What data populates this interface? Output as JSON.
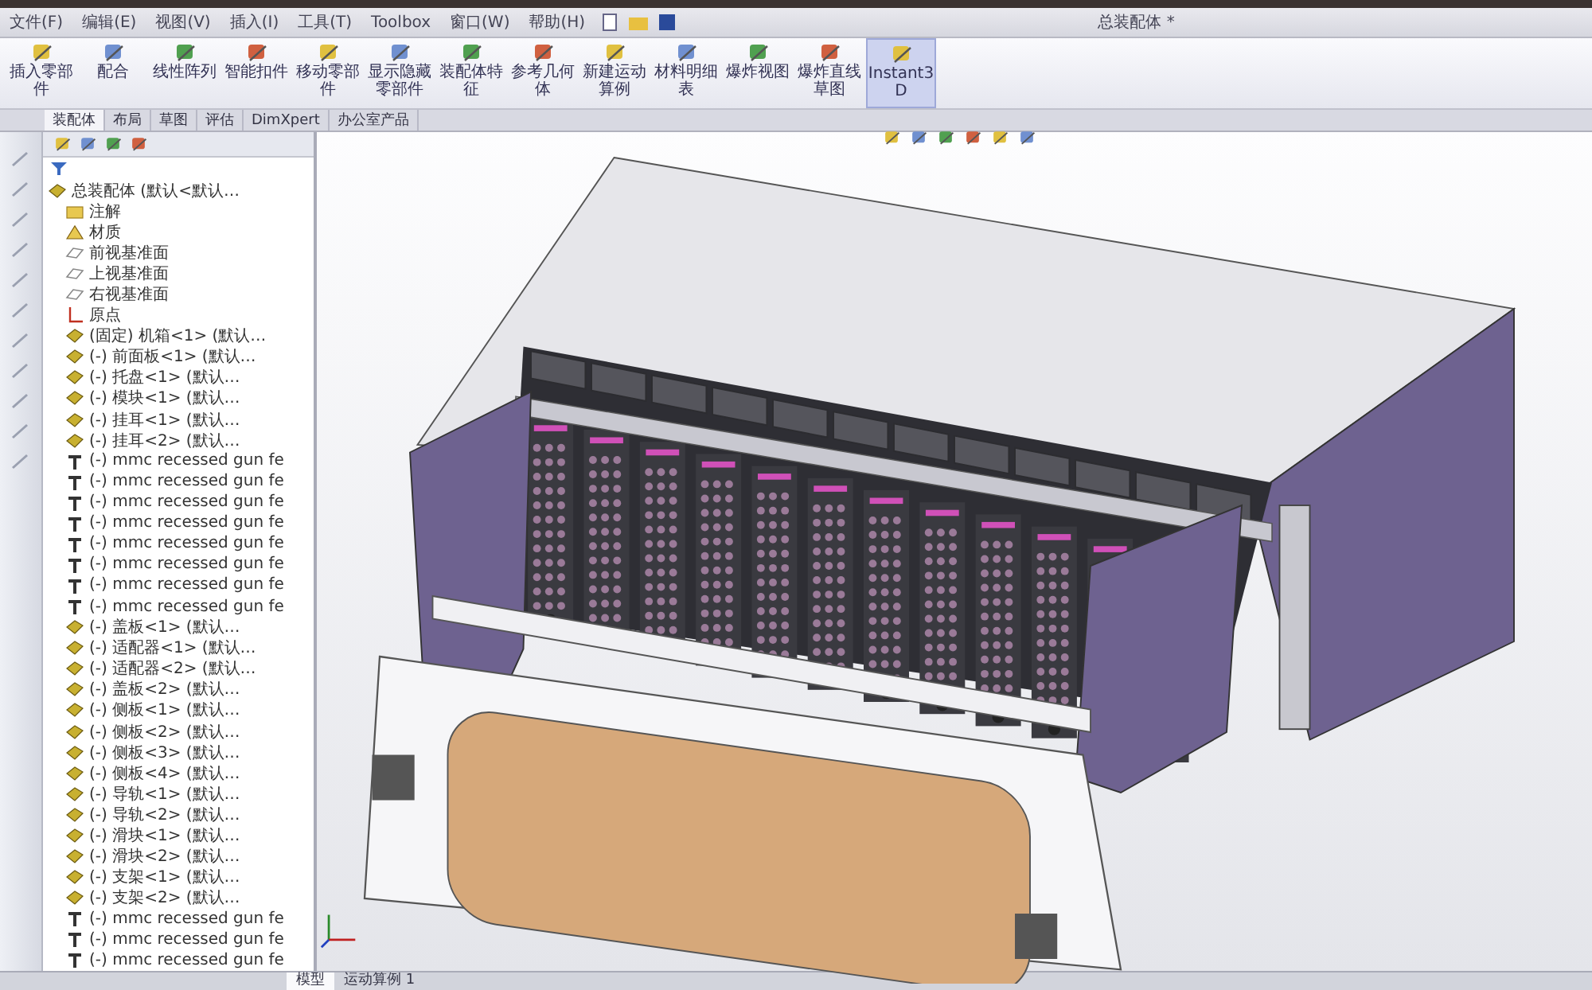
{
  "menu": [
    "文件(F)",
    "编辑(E)",
    "视图(V)",
    "插入(I)",
    "工具(T)",
    "Toolbox",
    "窗口(W)",
    "帮助(H)"
  ],
  "window": {
    "title": "总装配体 *"
  },
  "toolbar": [
    {
      "label": "插入零部件",
      "selected": false
    },
    {
      "label": "配合",
      "selected": false
    },
    {
      "label": "线性阵列",
      "selected": false
    },
    {
      "label": "智能扣件",
      "selected": false
    },
    {
      "label": "移动零部件",
      "selected": false
    },
    {
      "label": "显示隐藏零部件",
      "selected": false
    },
    {
      "label": "装配体特征",
      "selected": false
    },
    {
      "label": "参考几何体",
      "selected": false
    },
    {
      "label": "新建运动算例",
      "selected": false
    },
    {
      "label": "材料明细表",
      "selected": false
    },
    {
      "label": "爆炸视图",
      "selected": false
    },
    {
      "label": "爆炸直线草图",
      "selected": false
    },
    {
      "label": "Instant3D",
      "selected": true
    }
  ],
  "tabs": [
    {
      "label": "装配体",
      "selected": true
    },
    {
      "label": "布局",
      "selected": false
    },
    {
      "label": "草图",
      "selected": false
    },
    {
      "label": "评估",
      "selected": false
    },
    {
      "label": "DimXpert",
      "selected": false
    },
    {
      "label": "办公室产品",
      "selected": false
    }
  ],
  "tree": {
    "root": "总装配体 (默认<默认…",
    "items": [
      {
        "kind": "folder",
        "label": "注解"
      },
      {
        "kind": "material",
        "label": "材质"
      },
      {
        "kind": "plane",
        "label": "前视基准面"
      },
      {
        "kind": "plane",
        "label": "上视基准面"
      },
      {
        "kind": "plane",
        "label": "右视基准面"
      },
      {
        "kind": "origin",
        "label": "原点"
      },
      {
        "kind": "part",
        "label": "(固定) 机箱<1> (默认…"
      },
      {
        "kind": "part",
        "label": "(-) 前面板<1> (默认…"
      },
      {
        "kind": "part",
        "label": "(-) 托盘<1> (默认…"
      },
      {
        "kind": "part",
        "label": "(-) 模块<1> (默认…"
      },
      {
        "kind": "part",
        "label": "(-) 挂耳<1> (默认…"
      },
      {
        "kind": "part",
        "label": "(-) 挂耳<2> (默认…"
      },
      {
        "kind": "fastener",
        "label": "(-) mmc recessed gun fe"
      },
      {
        "kind": "fastener",
        "label": "(-) mmc recessed gun fe"
      },
      {
        "kind": "fastener",
        "label": "(-) mmc recessed gun fe"
      },
      {
        "kind": "fastener",
        "label": "(-) mmc recessed gun fe"
      },
      {
        "kind": "fastener",
        "label": "(-) mmc recessed gun fe"
      },
      {
        "kind": "fastener",
        "label": "(-) mmc recessed gun fe"
      },
      {
        "kind": "fastener",
        "label": "(-) mmc recessed gun fe"
      },
      {
        "kind": "fastener",
        "label": "(-) mmc recessed gun fe"
      },
      {
        "kind": "part",
        "label": "(-) 盖板<1> (默认…"
      },
      {
        "kind": "part",
        "label": "(-) 适配器<1> (默认…"
      },
      {
        "kind": "part",
        "label": "(-) 适配器<2> (默认…"
      },
      {
        "kind": "part",
        "label": "(-) 盖板<2> (默认…"
      },
      {
        "kind": "part",
        "label": "(-) 侧板<1> (默认…"
      },
      {
        "kind": "part",
        "label": "(-) 侧板<2> (默认…"
      },
      {
        "kind": "part",
        "label": "(-) 侧板<3> (默认…"
      },
      {
        "kind": "part",
        "label": "(-) 侧板<4> (默认…"
      },
      {
        "kind": "part",
        "label": "(-) 导轨<1> (默认…"
      },
      {
        "kind": "part",
        "label": "(-) 导轨<2> (默认…"
      },
      {
        "kind": "part",
        "label": "(-) 滑块<1> (默认…"
      },
      {
        "kind": "part",
        "label": "(-) 滑块<2> (默认…"
      },
      {
        "kind": "part",
        "label": "(-) 支架<1> (默认…"
      },
      {
        "kind": "part",
        "label": "(-) 支架<2> (默认…"
      },
      {
        "kind": "fastener",
        "label": "(-) mmc recessed gun fe"
      },
      {
        "kind": "fastener",
        "label": "(-) mmc recessed gun fe"
      },
      {
        "kind": "fastener",
        "label": "(-) mmc recessed gun fe"
      }
    ]
  },
  "bottom_tabs": [
    {
      "label": "模型",
      "selected": true
    },
    {
      "label": "运动算例 1",
      "selected": false
    }
  ]
}
